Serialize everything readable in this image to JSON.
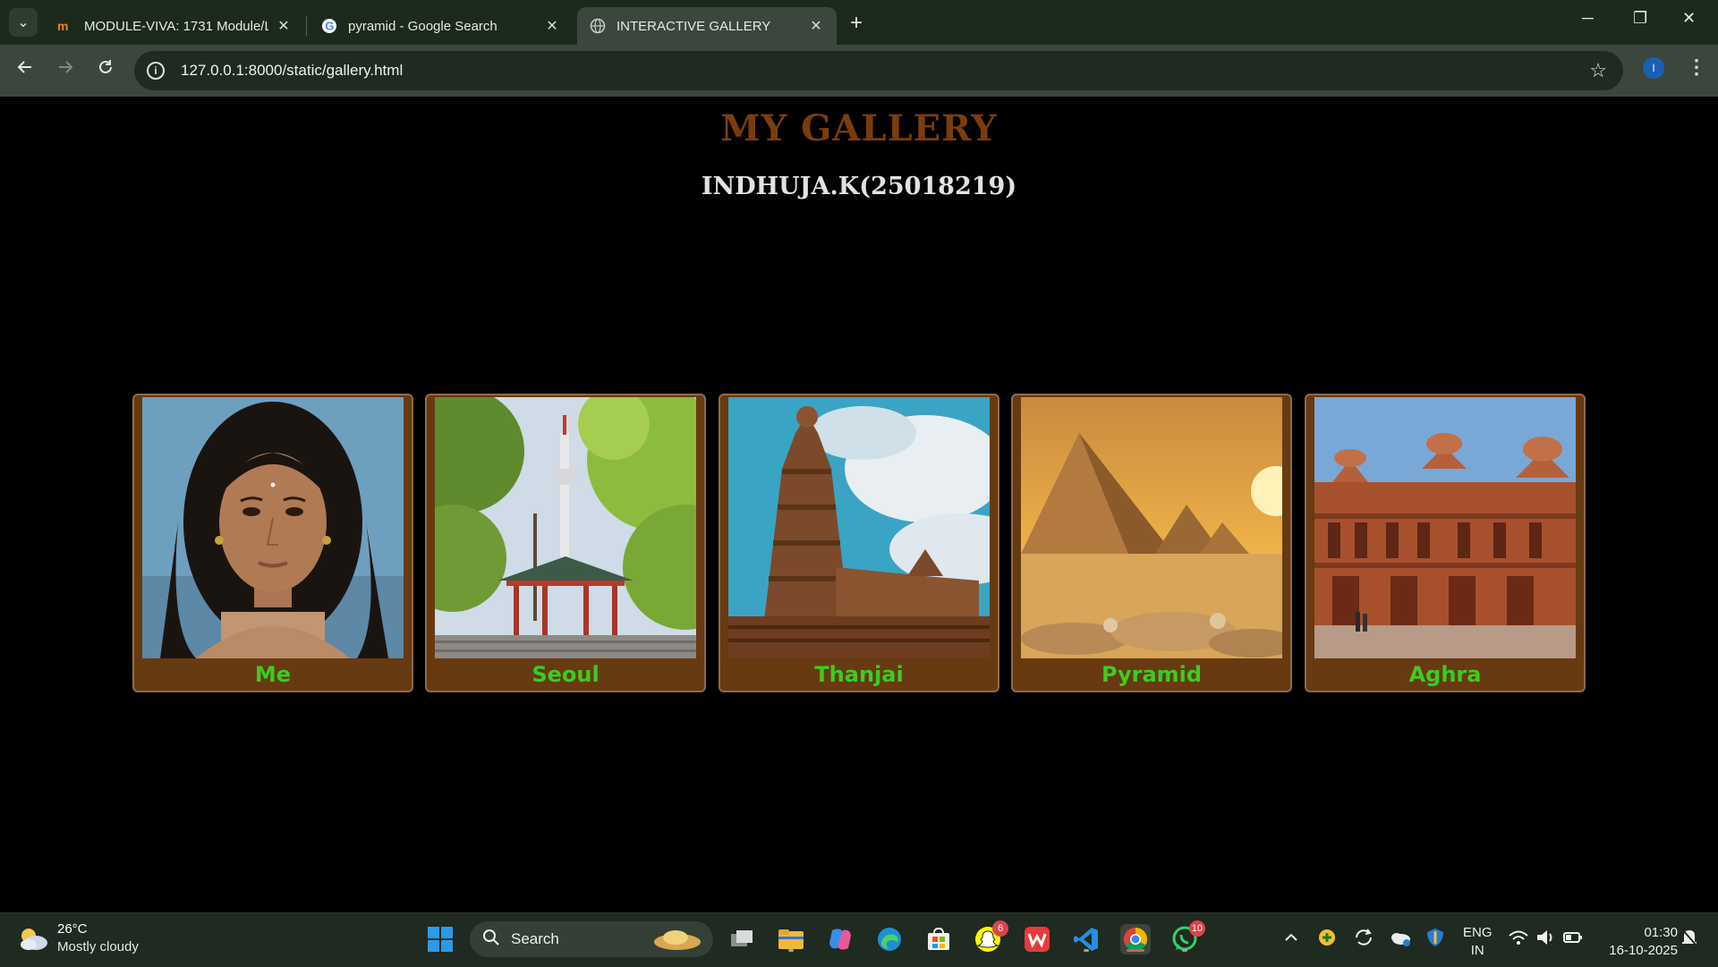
{
  "browser": {
    "tabs": [
      {
        "title": "MODULE-VIVA: 1731 Module/L",
        "favicon": "moodle-icon"
      },
      {
        "title": "pyramid - Google Search",
        "favicon": "google-icon"
      },
      {
        "title": "INTERACTIVE GALLERY",
        "favicon": "globe-icon",
        "active": true
      }
    ],
    "url": "127.0.0.1:8000/static/gallery.html",
    "profile_initial": "I"
  },
  "page": {
    "title": "MY GALLERY",
    "subtitle": "INDHUJA.K(25018219)",
    "cards": [
      {
        "caption": "Me",
        "image": "portrait-photo"
      },
      {
        "caption": "Seoul",
        "image": "seoul-tower-photo"
      },
      {
        "caption": "Thanjai",
        "image": "thanjavur-temple-photo"
      },
      {
        "caption": "Pyramid",
        "image": "pyramids-photo"
      },
      {
        "caption": "Aghra",
        "image": "agra-fort-photo"
      }
    ]
  },
  "taskbar": {
    "weather_temp": "26°C",
    "weather_condition": "Mostly cloudy",
    "search_label": "Search",
    "snapchat_badge": "6",
    "whatsapp_badge": "10",
    "lang_top": "ENG",
    "lang_bottom": "IN",
    "time": "01:30",
    "date": "16-10-2025"
  },
  "colors": {
    "title": "#7a3d0d",
    "card_bg": "#673a12",
    "caption": "#3dcc1f",
    "tabbar": "#1c2a1d",
    "toolbar": "#3b473c"
  }
}
